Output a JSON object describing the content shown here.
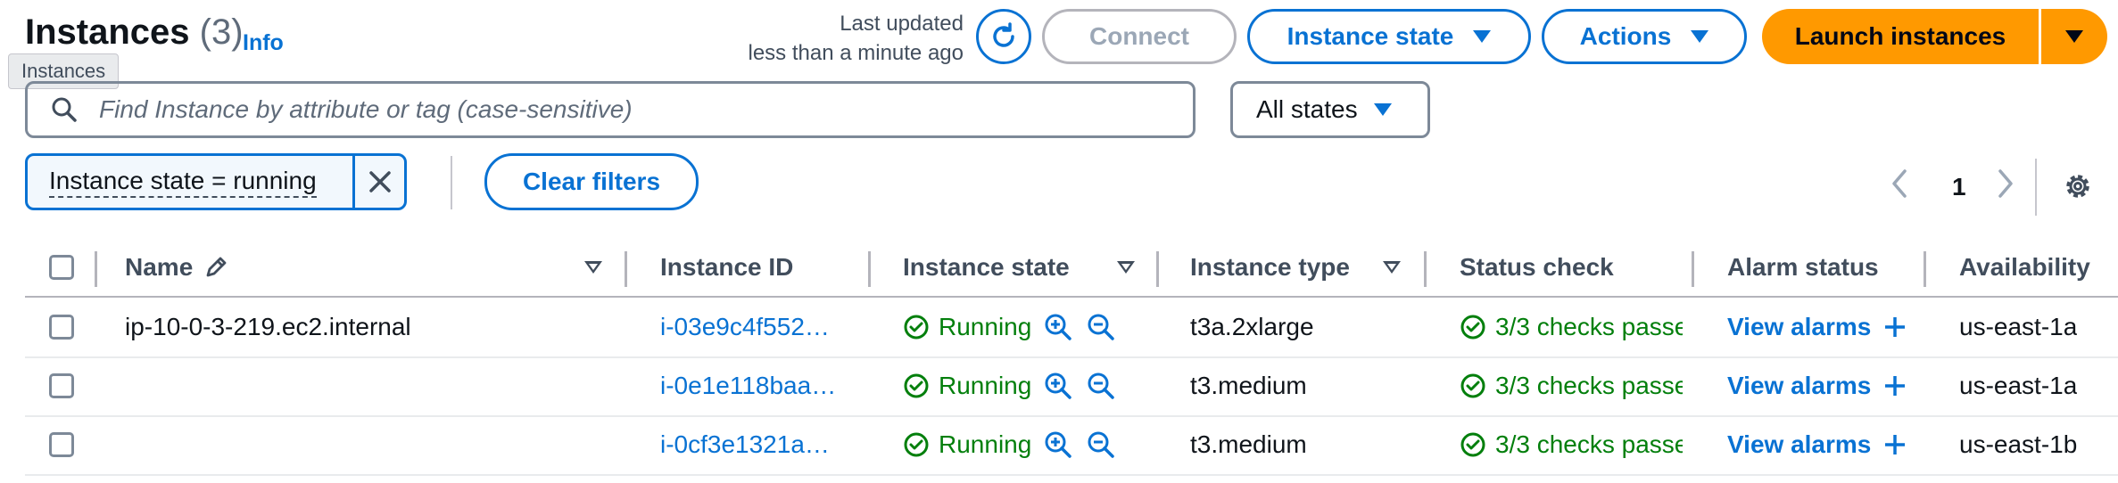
{
  "header": {
    "title": "Instances",
    "count": "(3)",
    "info": "Info",
    "tooltip": "Instances",
    "last_updated_line1": "Last updated",
    "last_updated_line2": "less than a minute ago",
    "connect": "Connect",
    "instance_state": "Instance state",
    "actions": "Actions",
    "launch": "Launch instances"
  },
  "filters": {
    "search_placeholder": "Find Instance by attribute or tag (case-sensitive)",
    "states_select": "All states",
    "token": "Instance state = running",
    "clear": "Clear filters"
  },
  "pagination": {
    "current_page": "1"
  },
  "table": {
    "headers": [
      "Name",
      "Instance ID",
      "Instance state",
      "Instance type",
      "Status check",
      "Alarm status",
      "Availability"
    ],
    "rows": [
      {
        "name": "ip-10-0-3-219.ec2.internal",
        "id": "i-03e9c4f552…",
        "state": "Running",
        "type": "t3a.2xlarge",
        "status": "3/3 checks passec",
        "alarm": "View alarms",
        "az": "us-east-1a"
      },
      {
        "name": "",
        "id": "i-0e1e118baa…",
        "state": "Running",
        "type": "t3.medium",
        "status": "3/3 checks passec",
        "alarm": "View alarms",
        "az": "us-east-1a"
      },
      {
        "name": "",
        "id": "i-0cf3e1321a…",
        "state": "Running",
        "type": "t3.medium",
        "status": "3/3 checks passec",
        "alarm": "View alarms",
        "az": "us-east-1b"
      }
    ]
  },
  "colors": {
    "primary": "#0972d3",
    "launch": "#ff9900",
    "success": "#037f0c"
  },
  "icons": [
    "refresh-icon",
    "caret-down-icon",
    "search-icon",
    "close-icon",
    "chevron-left-icon",
    "chevron-right-icon",
    "gear-icon",
    "pencil-icon",
    "sort-icon",
    "success-circle-icon",
    "zoom-in-icon",
    "zoom-out-icon",
    "plus-icon"
  ]
}
